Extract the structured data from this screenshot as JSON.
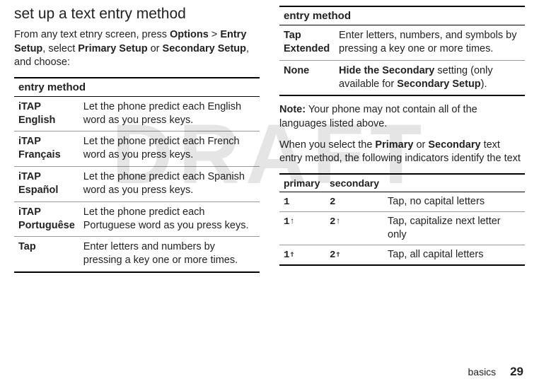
{
  "watermark": "DRAFT",
  "left": {
    "title": "set up a text entry method",
    "intro_parts": [
      "From any text etnry screen, press ",
      "Options",
      " > ",
      "Entry Setup",
      ", select ",
      "Primary Setup",
      " or ",
      "Secondary Setup",
      ", and choose:"
    ],
    "table_header": "entry method",
    "rows": [
      {
        "term": "iTAP English",
        "desc": "Let the phone predict each English word as you press keys."
      },
      {
        "term": "iTAP Français",
        "desc": "Let the phone predict each French word as you press keys."
      },
      {
        "term": "iTAP Español",
        "desc": "Let the phone predict each Spanish word as you press keys."
      },
      {
        "term": "iTAP Portuguêse",
        "desc": "Let the phone predict each Portuguese word as you press keys."
      },
      {
        "term": "Tap",
        "desc": "Enter letters and numbers by pressing a key one or more times."
      }
    ]
  },
  "right": {
    "table_header": "entry method",
    "rows": [
      {
        "term": "Tap Extended",
        "desc": "Enter letters, numbers, and symbols by pressing a key one or more times."
      },
      {
        "term": "None",
        "desc_bold": "Hide the Secondary",
        "desc_rest": " setting (only available for ",
        "desc_bold2": "Secondary Setup",
        "desc_tail": ")."
      }
    ],
    "note_label": "Note:",
    "note_text": " Your phone may not contain all of the languages listed above.",
    "para2_parts": [
      "When you select the ",
      "Primary",
      " or ",
      "Secondary",
      " text entry method, the following indicators identify the text"
    ],
    "ind_headers": {
      "primary": "primary",
      "secondary": "secondary"
    },
    "ind_rows": [
      {
        "p": "1",
        "p_arr": "",
        "s": "2",
        "s_arr": "",
        "desc": "Tap, no capital letters"
      },
      {
        "p": "1",
        "p_arr": "↑",
        "s": "2",
        "s_arr": "↑",
        "desc": "Tap, capitalize next letter only"
      },
      {
        "p": "1",
        "p_arr": "⇑",
        "s": "2",
        "s_arr": "⇑",
        "desc": "Tap, all capital letters"
      }
    ]
  },
  "footer": {
    "label": "basics",
    "page": "29"
  }
}
